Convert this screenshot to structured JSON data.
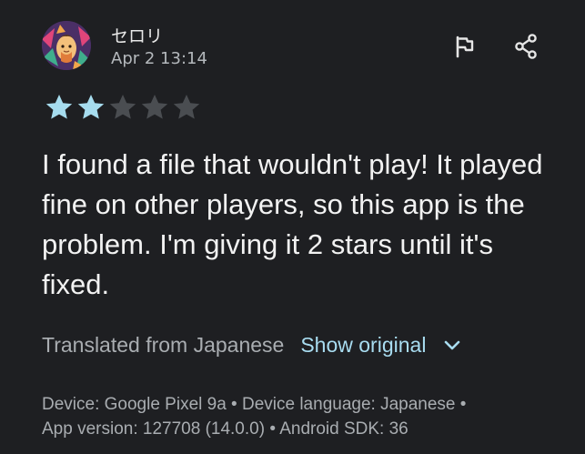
{
  "review": {
    "author": "セロリ",
    "date": "Apr 2 13:14",
    "rating": 2,
    "max_rating": 5,
    "text": "I found a file that wouldn't play! It played fine on other players, so this app is the problem. I'm giving it 2 stars until it's fixed."
  },
  "translation": {
    "label": "Translated from Japanese",
    "show_original": "Show original"
  },
  "device_info": {
    "line1": "Device: Google Pixel 9a • Device language: Japanese •",
    "line2": "App version: 127708 (14.0.0) • Android SDK: 36"
  },
  "icons": {
    "flag": "flag-icon",
    "share": "share-icon",
    "expand": "chevron-down-icon"
  },
  "colors": {
    "background": "#1e1f22",
    "star_filled": "#a6dcee",
    "star_empty": "#4a4d51",
    "link": "#a8dcf0"
  }
}
